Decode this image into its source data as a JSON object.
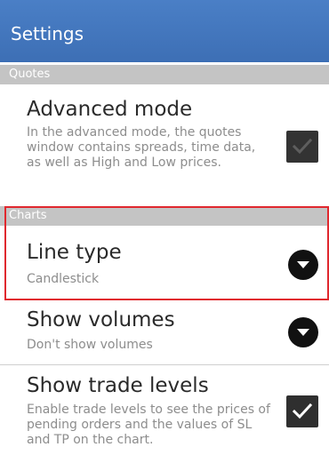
{
  "app_bar": {
    "title": "Settings"
  },
  "sections": {
    "quotes": "Quotes",
    "charts": "Charts"
  },
  "settings": {
    "advanced_mode": {
      "title": "Advanced mode",
      "description": "In the advanced mode, the quotes window contains spreads, time data, as well as High and Low prices.",
      "checked": true,
      "enabled": false
    },
    "line_type": {
      "title": "Line type",
      "value": "Candlestick"
    },
    "show_volumes": {
      "title": "Show volumes",
      "value": "Don't show volumes"
    },
    "show_trade_levels": {
      "title": "Show trade levels",
      "description": "Enable trade levels to see the prices of pending orders and the values of SL and TP on the chart.",
      "checked": true,
      "enabled": true
    }
  },
  "colors": {
    "app_bar": "#4176bd",
    "section_header": "#c4c4c4",
    "highlight": "#e0282e",
    "title_text": "#2a2a2a",
    "secondary_text": "#8d8d8d"
  },
  "icons": {
    "checkbox": "check-icon",
    "dropdown": "chevron-down-icon"
  }
}
